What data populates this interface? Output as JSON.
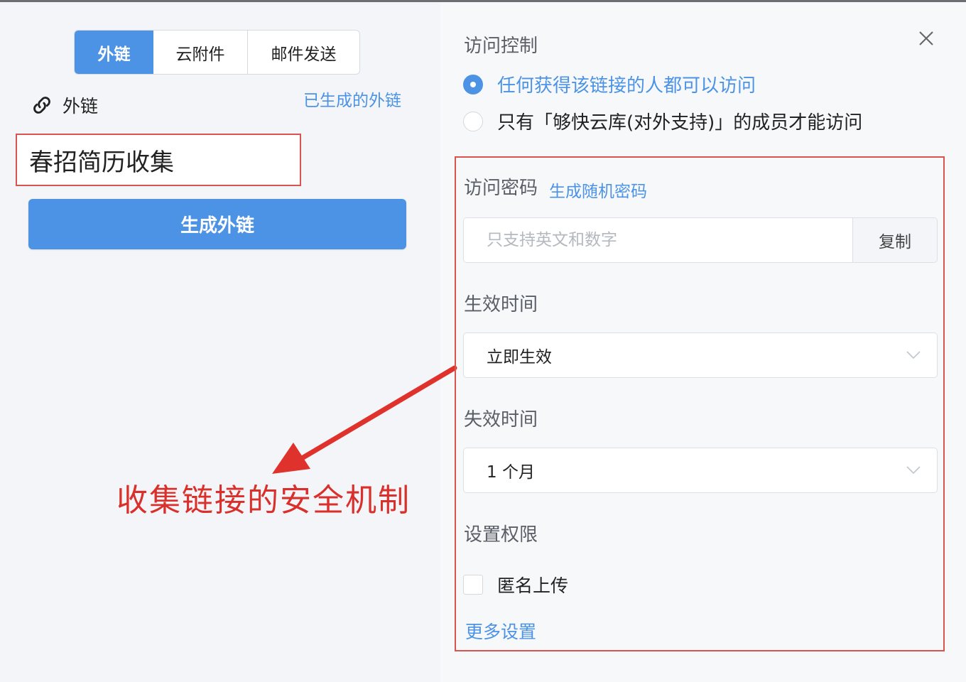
{
  "tabs": [
    {
      "label": "外链",
      "active": true
    },
    {
      "label": "云附件",
      "active": false
    },
    {
      "label": "邮件发送",
      "active": false
    }
  ],
  "link_section": {
    "icon": "link-icon",
    "label": "外链",
    "generated_links": "已生成的外链",
    "name_value": "春招简历收集",
    "generate_button": "生成外链"
  },
  "annotation": {
    "text": "收集链接的安全机制",
    "color": "#d9302b"
  },
  "access_control": {
    "title": "访问控制",
    "close_icon": "close-icon",
    "options": [
      {
        "label": "任何获得该链接的人都可以访问",
        "checked": true
      },
      {
        "label": "只有「够快云库(对外支持)」的成员才能访问",
        "checked": false
      }
    ]
  },
  "password": {
    "label": "访问密码",
    "random_link": "生成随机密码",
    "placeholder": "只支持英文和数字",
    "value": "",
    "copy_button": "复制"
  },
  "effective_time": {
    "label": "生效时间",
    "selected": "立即生效"
  },
  "expire_time": {
    "label": "失效时间",
    "selected": "1 个月"
  },
  "permissions": {
    "label": "设置权限",
    "anonymous_upload": {
      "label": "匿名上传",
      "checked": false
    },
    "more_settings": "更多设置"
  },
  "colors": {
    "accent": "#4c93e6",
    "highlight_border": "#d9534f"
  }
}
